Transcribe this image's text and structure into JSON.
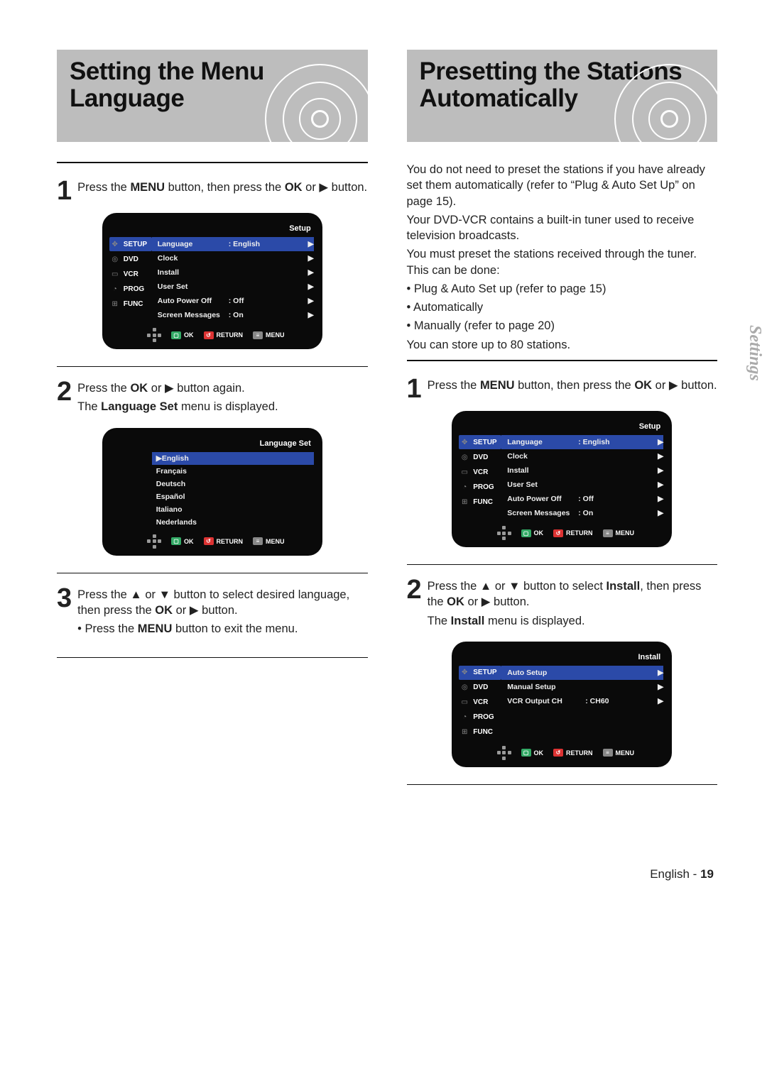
{
  "headings": {
    "left": "Setting the Menu Language",
    "right": "Presetting the Stations Automatically"
  },
  "left": {
    "step1_a": "Press the ",
    "step1_b": "MENU",
    "step1_c": " button, then press the ",
    "step1_d": "OK",
    "step1_e": " or ▶ button.",
    "step2_a": "Press the ",
    "step2_b": "OK",
    "step2_c": " or ▶ button again.",
    "step2_d": "The ",
    "step2_e": "Language Set",
    "step2_f": " menu is displayed.",
    "step3_a": "Press the ▲ or ▼ button to select desired language, then press the ",
    "step3_b": "OK",
    "step3_c": " or ▶ button.",
    "step3_bullet_a": "• Press the ",
    "step3_bullet_b": "MENU",
    "step3_bullet_c": " button to exit the menu."
  },
  "right": {
    "intro1": "You do not need to preset the stations if you have already set them automatically (refer to “Plug & Auto Set Up” on page 15).",
    "intro2": "Your DVD-VCR contains a built-in tuner used to receive television broadcasts.",
    "intro3": "You must preset the stations received through the tuner. This can be done:",
    "b1": "• Plug & Auto Set up (refer to page 15)",
    "b2": "• Automatically",
    "b3": "• Manually (refer to page 20)",
    "intro4": "You can store up to 80 stations.",
    "step1_a": "Press the ",
    "step1_b": "MENU",
    "step1_c": " button, then press the ",
    "step1_d": "OK",
    "step1_e": " or ▶ button.",
    "step2_a": "Press the ▲ or ▼ button to select ",
    "step2_b": "Install",
    "step2_c": ", then press the ",
    "step2_d": "OK",
    "step2_e": " or ▶ button.",
    "step2_f": "The ",
    "step2_g": "Install",
    "step2_h": " menu is displayed."
  },
  "osd_setup": {
    "title": "Setup",
    "side": [
      "SETUP",
      "DVD",
      "VCR",
      "PROG",
      "FUNC"
    ],
    "side_selected": 0,
    "rows": [
      {
        "label": "Language",
        "value": ": English",
        "sel": true
      },
      {
        "label": "Clock",
        "value": "",
        "sel": false
      },
      {
        "label": "Install",
        "value": "",
        "sel": false
      },
      {
        "label": "User Set",
        "value": "",
        "sel": false
      },
      {
        "label": "Auto Power Off",
        "value": ": Off",
        "sel": false
      },
      {
        "label": "Screen Messages",
        "value": ": On",
        "sel": false
      }
    ],
    "foot": {
      "ok": "OK",
      "ret": "RETURN",
      "menu": "MENU"
    }
  },
  "osd_lang": {
    "title": "Language Set",
    "rows": [
      {
        "label": "▶English",
        "sel": true
      },
      {
        "label": "Français",
        "sel": false
      },
      {
        "label": "Deutsch",
        "sel": false
      },
      {
        "label": "Español",
        "sel": false
      },
      {
        "label": "Italiano",
        "sel": false
      },
      {
        "label": "Nederlands",
        "sel": false
      }
    ],
    "foot": {
      "ok": "OK",
      "ret": "RETURN",
      "menu": "MENU"
    }
  },
  "osd_install": {
    "title": "Install",
    "side": [
      "SETUP",
      "DVD",
      "VCR",
      "PROG",
      "FUNC"
    ],
    "side_selected": 0,
    "rows": [
      {
        "label": "Auto Setup",
        "value": "",
        "sel": true
      },
      {
        "label": "Manual Setup",
        "value": "",
        "sel": false
      },
      {
        "label": "VCR Output CH",
        "value": ": CH60",
        "sel": false
      }
    ],
    "foot": {
      "ok": "OK",
      "ret": "RETURN",
      "menu": "MENU"
    }
  },
  "sidetab": "Settings",
  "footer": {
    "lang": "English - ",
    "page": "19"
  }
}
